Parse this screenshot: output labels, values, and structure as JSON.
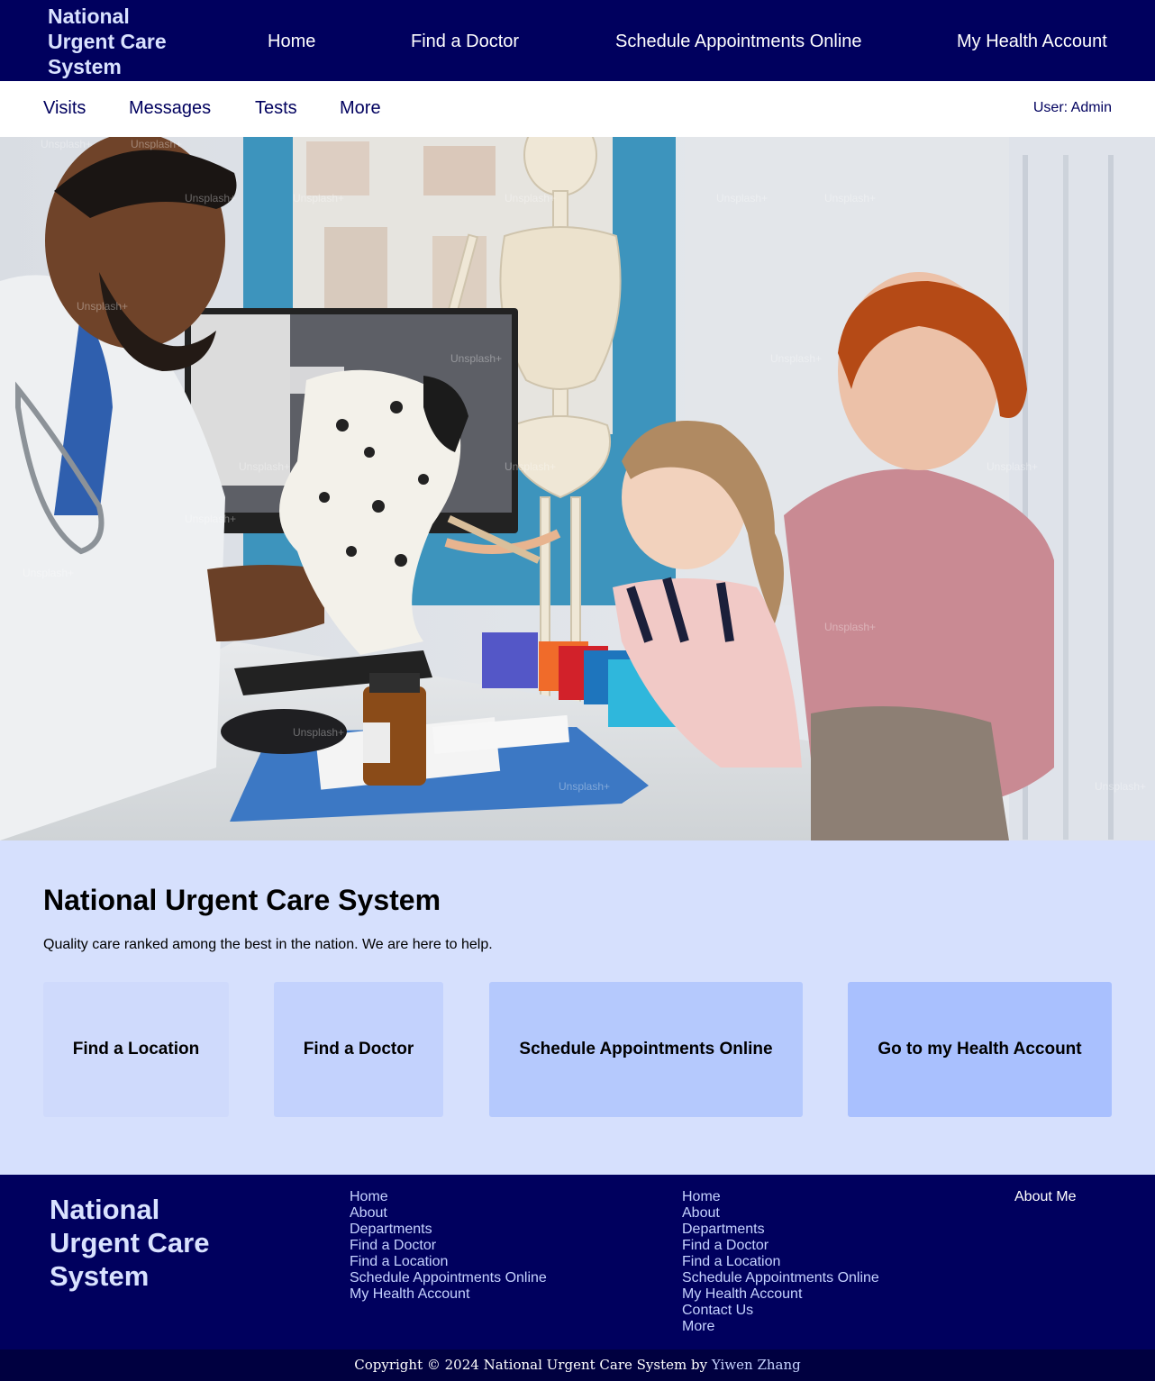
{
  "header": {
    "brand": "National Urgent Care System",
    "nav": [
      "Home",
      "Find a Doctor",
      "Schedule Appointments Online",
      "My Health Account"
    ]
  },
  "subnav": {
    "items": [
      "Visits",
      "Messages",
      "Tests",
      "More"
    ],
    "user": "User: Admin"
  },
  "hero": {
    "image_alt": "Doctor with a puppet examining a young girl sitting on her mother's lap",
    "watermark": "Unsplash+"
  },
  "intro": {
    "title": "National Urgent Care System",
    "tagline": "Quality care ranked among the best in the nation. We are here to help."
  },
  "cards": [
    {
      "label": "Find a Location",
      "color": "#cfdafc"
    },
    {
      "label": "Find a Doctor",
      "color": "#c3d2fd"
    },
    {
      "label": "Schedule Appointments Online",
      "color": "#b5c9fd"
    },
    {
      "label": "Go to my Health Account",
      "color": "#a9c0fe"
    }
  ],
  "footer": {
    "brand": "National Urgent Care System",
    "col1": [
      "Home",
      "About",
      "Departments",
      "Find a Doctor",
      "Find a Location",
      "Schedule Appointments Online",
      "My Health Account"
    ],
    "col2": [
      "Home",
      "About",
      "Departments",
      "Find a Doctor",
      "Find a Location",
      "Schedule Appointments Online",
      "My Health Account",
      "Contact Us",
      "More"
    ],
    "about": "About Me",
    "copyright": "Copyright © 2024 National Urgent Care System by",
    "author": "Yiwen Zhang"
  },
  "colors": {
    "navy": "#00005e",
    "page_bg": "#d6e0fd",
    "link_light": "#c5d2ff"
  }
}
